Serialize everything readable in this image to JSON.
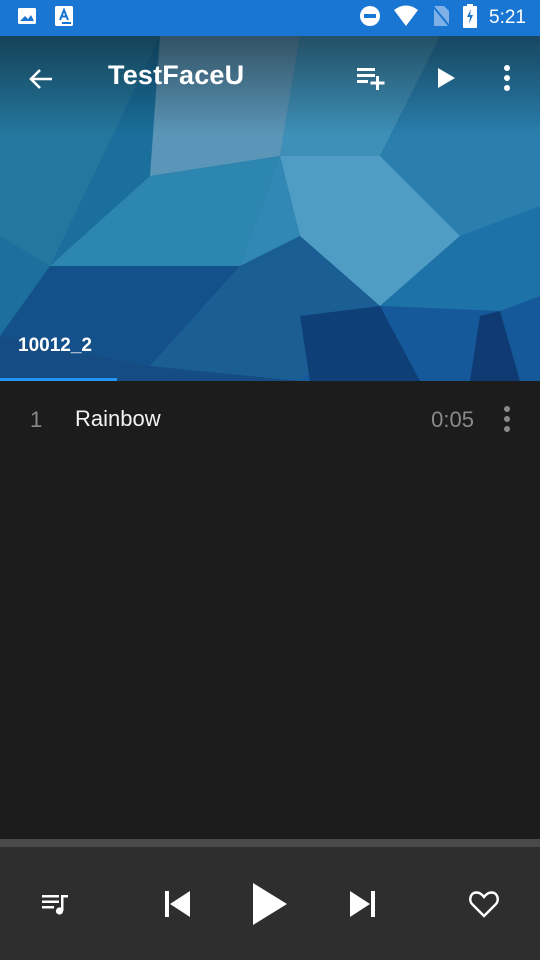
{
  "status_bar": {
    "time": "5:21",
    "left_icons": [
      "image-icon",
      "font-a-icon"
    ],
    "right_icons": [
      "do-not-disturb-icon",
      "wifi-icon",
      "no-sim-icon",
      "battery-charging-icon"
    ]
  },
  "toolbar": {
    "title": "TestFaceU",
    "actions": [
      "add-to-playlist",
      "play",
      "more-options"
    ]
  },
  "tabs": [
    {
      "label": "10012_2",
      "selected": true
    }
  ],
  "tracks": [
    {
      "number": "1",
      "title": "Rainbow",
      "duration": "0:05"
    }
  ],
  "player": {
    "progress_fraction": 0,
    "controls": [
      "queue",
      "previous",
      "play",
      "next",
      "favorite"
    ]
  },
  "colors": {
    "status_bar": "#1976d2",
    "accent": "#2196f3",
    "list_background": "#1c1c1c",
    "player_background": "#2e2e2e"
  }
}
